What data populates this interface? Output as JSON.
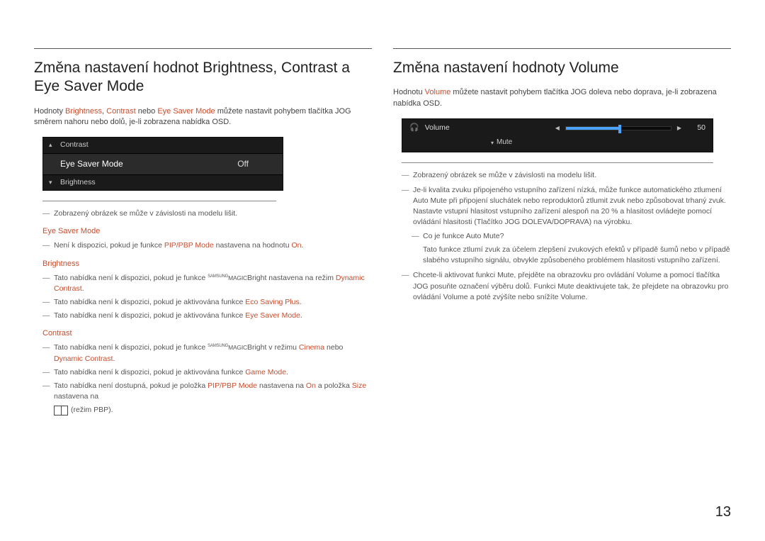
{
  "pageNumber": "13",
  "left": {
    "title": "Změna nastavení hodnot Brightness, Contrast a Eye Saver Mode",
    "intro_pre": "Hodnoty ",
    "intro_h1": "Brightness",
    "intro_sep1": ", ",
    "intro_h2": "Contrast",
    "intro_sep2": " nebo ",
    "intro_h3": "Eye Saver Mode",
    "intro_post": " můžete nastavit pohybem tlačítka JOG směrem nahoru nebo dolů, je-li zobrazena nabídka OSD.",
    "osd": {
      "contrast": "Contrast",
      "eyesaver": "Eye Saver Mode",
      "off": "Off",
      "brightness": "Brightness"
    },
    "disclaimer": "Zobrazený obrázek se může v závislosti na modelu lišit.",
    "sec1": {
      "head": "Eye Saver Mode",
      "b1_pre": "Není k dispozici, pokud je funkce ",
      "b1_h1": "PIP/PBP Mode",
      "b1_mid": " nastavena na hodnotu ",
      "b1_h2": "On",
      "b1_post": "."
    },
    "sec2": {
      "head": "Brightness",
      "b1_pre": "Tato nabídka není k dispozici, pokud je funkce ",
      "b1_magic_s": "SAMSUNG",
      "b1_magic_m": "MAGIC",
      "b1_bright": "Bright",
      "b1_mid": " nastavena na režim ",
      "b1_h1": "Dynamic Contrast",
      "b1_post": ".",
      "b2_pre": "Tato nabídka není k dispozici, pokud je aktivována funkce ",
      "b2_h1": "Eco Saving Plus",
      "b2_post": ".",
      "b3_pre": "Tato nabídka není k dispozici, pokud je aktivována funkce ",
      "b3_h1": "Eye Saver Mode",
      "b3_post": "."
    },
    "sec3": {
      "head": "Contrast",
      "b1_pre": "Tato nabídka není k dispozici, pokud je funkce ",
      "b1_magic_s": "SAMSUNG",
      "b1_magic_m": "MAGIC",
      "b1_bright": "Bright",
      "b1_mid": " v režimu ",
      "b1_h1": "Cinema",
      "b1_sep": " nebo ",
      "b1_h2": "Dynamic Contrast",
      "b1_post": ".",
      "b2_pre": "Tato nabídka není k dispozici, pokud je aktivována funkce ",
      "b2_h1": "Game Mode",
      "b2_post": ".",
      "b3_pre": "Tato nabídka není dostupná, pokud je položka ",
      "b3_h1": "PIP/PBP Mode",
      "b3_mid1": " nastavena na ",
      "b3_h2": "On",
      "b3_mid2": " a položka ",
      "b3_h3": "Size",
      "b3_post": " nastavena na",
      "b3_line2": " (režim PBP)."
    }
  },
  "right": {
    "title": "Změna nastavení hodnoty Volume",
    "intro_pre": "Hodnotu ",
    "intro_h1": "Volume",
    "intro_post": " můžete nastavit pohybem tlačítka JOG doleva nebo doprava, je-li zobrazena nabídka OSD.",
    "osd": {
      "volume": "Volume",
      "value": "50",
      "mute": "Mute"
    },
    "disclaimer": "Zobrazený obrázek se může v závislosti na modelu lišit.",
    "b2": "Je-li kvalita zvuku připojeného vstupního zařízení nízká, může funkce automatického ztlumení Auto Mute při připojení sluchátek nebo reproduktorů ztlumit zvuk nebo způsobovat trhaný zvuk. Nastavte vstupní hlasitost vstupního zařízení alespoň na 20 % a hlasitost ovládejte pomocí ovládání hlasitosti (Tlačítko JOG DOLEVA/DOPRAVA) na výrobku.",
    "b2_sub_q": "Co je funkce Auto Mute?",
    "b2_sub_a": "Tato funkce ztlumí zvuk za účelem zlepšení zvukových efektů v případě šumů nebo v případě slabého vstupního signálu, obvykle způsobeného problémem hlasitosti vstupního zařízení.",
    "b3_pre": "Chcete-li aktivovat funkci ",
    "b3_h1": "Mute",
    "b3_mid1": ", přejděte na obrazovku pro ovládání ",
    "b3_h2": "Volume",
    "b3_mid2": " a pomocí tlačítka JOG posuňte označení výběru dolů. Funkci ",
    "b3_h3": "Mute",
    "b3_mid3": " deaktivujete tak, že přejdete na obrazovku pro ovládání ",
    "b3_h4": "Volume",
    "b3_mid4": " a poté zvýšíte nebo snížíte ",
    "b3_h5": "Volume",
    "b3_post": "."
  }
}
